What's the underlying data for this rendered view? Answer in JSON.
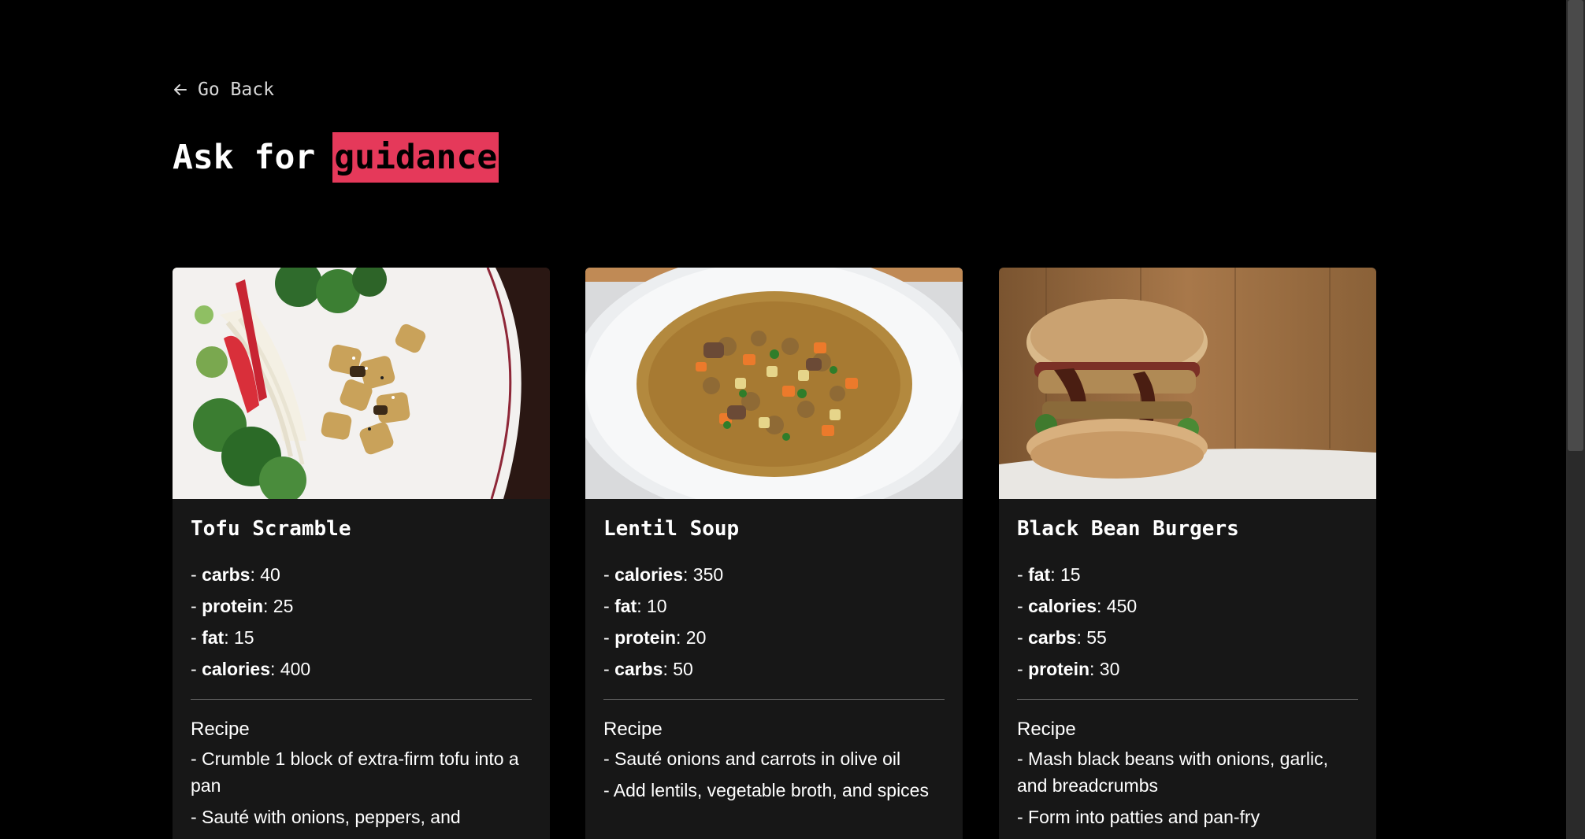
{
  "nav": {
    "back_icon": "arrow-left-icon",
    "back_label": "Go Back"
  },
  "heading": {
    "prefix": "Ask for",
    "highlight": "guidance",
    "highlight_color": "#e5395a"
  },
  "cards": [
    {
      "title": "Tofu Scramble",
      "image": "tofu-noodle-bowl-photo",
      "nutrients": [
        {
          "name": "carbs",
          "value": "40"
        },
        {
          "name": "protein",
          "value": "25"
        },
        {
          "name": "fat",
          "value": "15"
        },
        {
          "name": "calories",
          "value": "400"
        }
      ],
      "recipe_label": "Recipe",
      "steps": [
        "- Crumble 1 block of extra-firm tofu into a pan",
        "- Sauté with onions, peppers, and"
      ]
    },
    {
      "title": "Lentil Soup",
      "image": "lentil-soup-bowl-photo",
      "nutrients": [
        {
          "name": "calories",
          "value": "350"
        },
        {
          "name": "fat",
          "value": "10"
        },
        {
          "name": "protein",
          "value": "20"
        },
        {
          "name": "carbs",
          "value": "50"
        }
      ],
      "recipe_label": "Recipe",
      "steps": [
        "- Sauté onions and carrots in olive oil",
        "- Add lentils, vegetable broth, and spices"
      ]
    },
    {
      "title": "Black Bean Burgers",
      "image": "black-bean-burger-photo",
      "nutrients": [
        {
          "name": "fat",
          "value": "15"
        },
        {
          "name": "calories",
          "value": "450"
        },
        {
          "name": "carbs",
          "value": "55"
        },
        {
          "name": "protein",
          "value": "30"
        }
      ],
      "recipe_label": "Recipe",
      "steps": [
        "- Mash black beans with onions, garlic, and breadcrumbs",
        "- Form into patties and pan-fry"
      ]
    }
  ]
}
